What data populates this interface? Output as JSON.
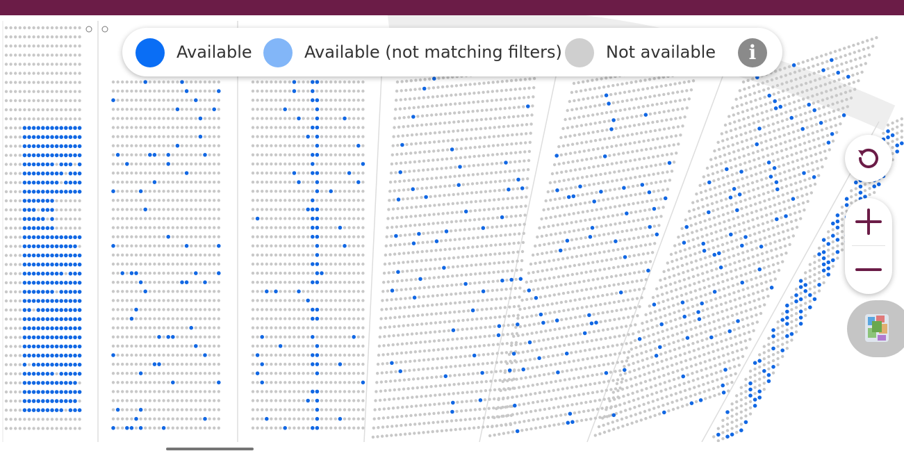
{
  "header": {
    "bar_color": "#6b1c47"
  },
  "legend": {
    "items": [
      {
        "label": "Available",
        "color": "#0a6ef5"
      },
      {
        "label": "Available (not matching filters)",
        "color": "#82b6f8"
      },
      {
        "label": "Not available",
        "color": "#cfcfcf"
      }
    ],
    "info_icon": "info-icon"
  },
  "map_controls": {
    "reset_icon": "reset-view-icon",
    "zoom_in_icon": "plus-icon",
    "zoom_out_icon": "minus-icon",
    "minimap_icon": "stadium-overview-thumbnail",
    "icon_color": "#6b1c47"
  },
  "seat_colors": {
    "available": "#1167e3",
    "unavailable": "#c8c8c8"
  },
  "page_scroll_indicator": true
}
